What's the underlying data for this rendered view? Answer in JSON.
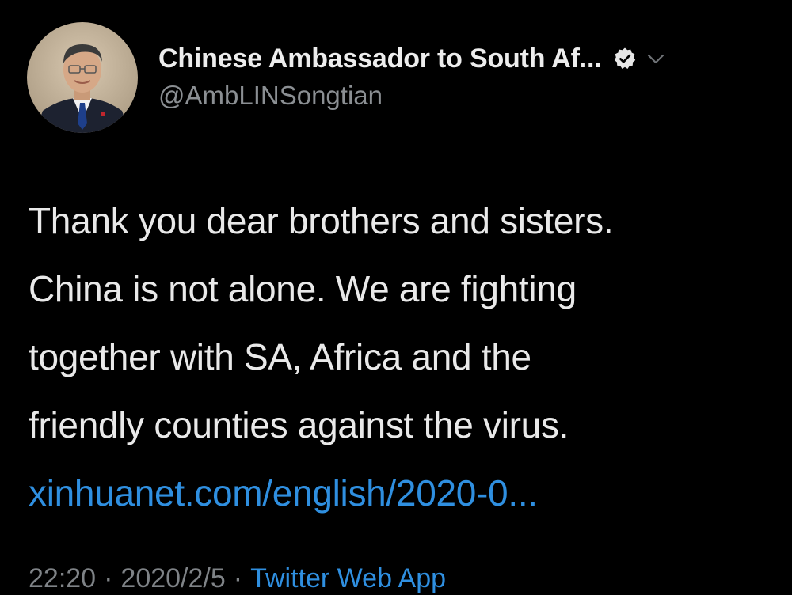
{
  "author": {
    "display_name": "Chinese Ambassador to South Af...",
    "handle": "@AmbLINSongtian",
    "verified_icon": "verified-badge-icon",
    "menu_icon": "chevron-down-icon",
    "avatar_icon": "profile-avatar"
  },
  "tweet": {
    "lines": [
      "Thank you dear brothers and sisters.",
      "China is not alone. We are fighting",
      "together with SA, Africa and the",
      "friendly counties against the virus."
    ],
    "link": "xinhuanet.com/english/2020-0..."
  },
  "meta": {
    "time": "22:20",
    "separator_1": "·",
    "date": "2020/2/5",
    "separator_2": "·",
    "source": "Twitter Web App"
  },
  "colors": {
    "background": "#000000",
    "text": "#e9e9e9",
    "secondary": "#8b8f93",
    "link": "#2f8fe0"
  }
}
